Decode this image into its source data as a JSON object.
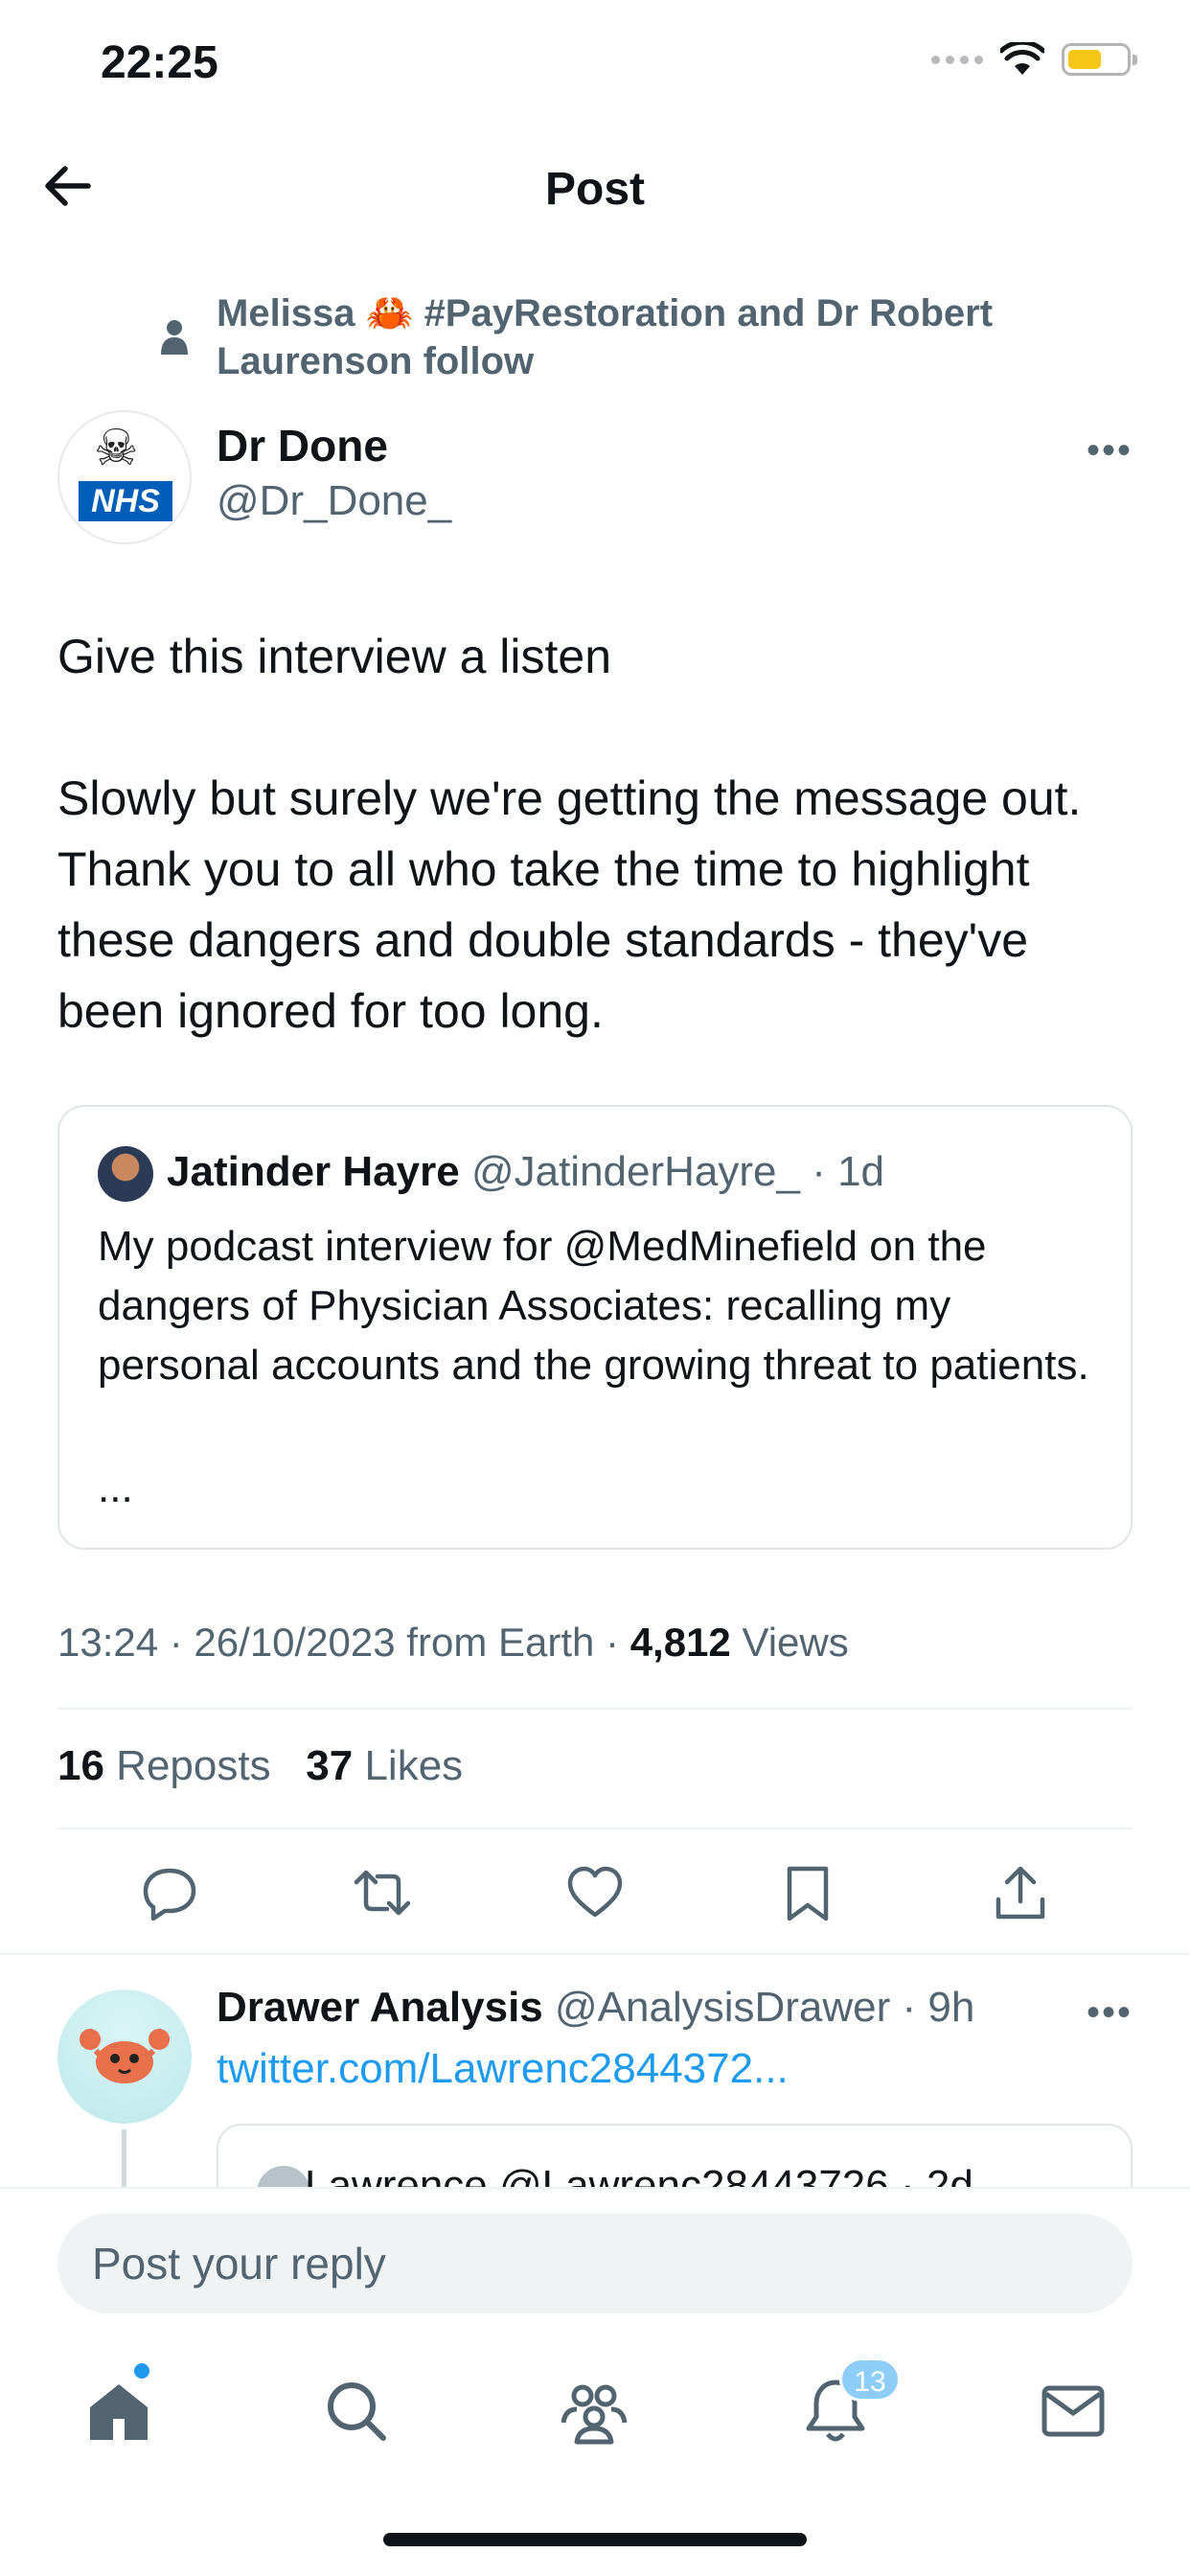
{
  "status_bar": {
    "time": "22:25"
  },
  "header": {
    "title": "Post"
  },
  "social_context": {
    "text": "Melissa 🦀 #PayRestoration and Dr Robert Laurenson follow"
  },
  "post": {
    "author": {
      "name": "Dr Done",
      "handle": "@Dr_Done_",
      "avatar_label": "NHS"
    },
    "text": "Give this interview a listen\n\nSlowly but surely we're getting the message out. Thank you to all who take the time to highlight these dangers and double standards - they've been ignored for too long.",
    "quoted": {
      "name": "Jatinder Hayre",
      "meta": "@JatinderHayre_ · 1d",
      "text": "My podcast interview for @MedMinefield on the dangers of Physician Associates: recalling my personal accounts and the growing threat to patients.",
      "ellipsis": "..."
    },
    "timestamp": "13:24 · 26/10/2023 from Earth · ",
    "views_count": "4,812",
    "views_label": " Views",
    "reposts_count": "16",
    "reposts_label": " Reposts",
    "likes_count": "37",
    "likes_label": " Likes"
  },
  "reply": {
    "name": "Drawer Analysis",
    "meta": "@AnalysisDrawer · 9h",
    "link": "twitter.com/Lawrenc2844372...",
    "quoted_partial": "Lawrence @Lawrenc28443726 · 2d"
  },
  "composer": {
    "placeholder": "Post your reply"
  },
  "tab_bar": {
    "notifications_badge": "13"
  },
  "icons": {
    "back": "arrow-left-icon",
    "more": "more-icon",
    "reply": "reply-icon",
    "repost": "repost-icon",
    "like": "heart-icon",
    "bookmark": "bookmark-icon",
    "share": "share-icon",
    "home": "home-icon",
    "search": "search-icon",
    "communities": "communities-icon",
    "notifications": "bell-icon",
    "messages": "mail-icon"
  },
  "colors": {
    "accent": "#1d9bf0",
    "text": "#0f1419",
    "secondary": "#536471",
    "nhs_blue": "#005eb8"
  }
}
